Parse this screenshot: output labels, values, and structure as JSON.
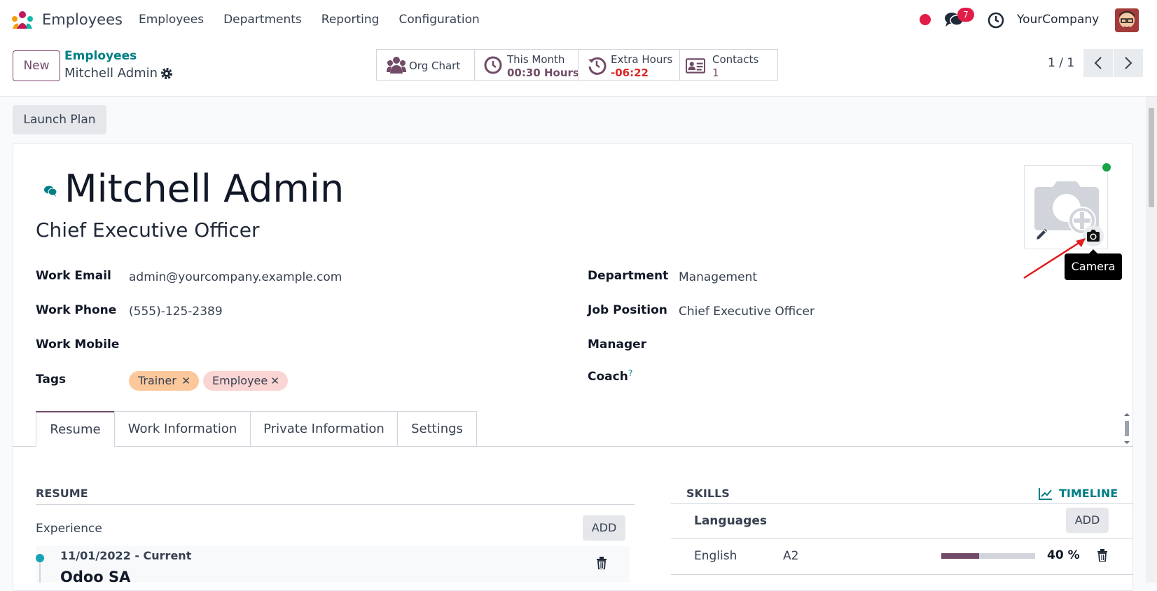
{
  "nav": {
    "app_name": "Employees",
    "menu": [
      "Employees",
      "Departments",
      "Reporting",
      "Configuration"
    ],
    "messages_count": "7",
    "company": "YourCompany"
  },
  "control": {
    "new_label": "New",
    "breadcrumb_parent": "Employees",
    "breadcrumb_current": "Mitchell Admin",
    "smart_buttons": [
      {
        "icon": "org-chart-icon",
        "label": "Org Chart",
        "value": ""
      },
      {
        "icon": "clock-icon",
        "label": "This Month",
        "value": "00:30 Hours",
        "value_color": "#714b67"
      },
      {
        "icon": "history-icon",
        "label": "Extra Hours",
        "value": "-06:22",
        "value_color": "#dc2626"
      },
      {
        "icon": "contact-card-icon",
        "label": "Contacts",
        "value": "1",
        "value_color": "#714b67"
      }
    ],
    "pager": "1 / 1"
  },
  "actions": {
    "launch_plan": "Launch Plan"
  },
  "employee": {
    "name": "Mitchell Admin",
    "job_title": "Chief Executive Officer",
    "photo_tooltip": "Camera",
    "fields_left": [
      {
        "label": "Work Email",
        "value": "admin@yourcompany.example.com"
      },
      {
        "label": "Work Phone",
        "value": "(555)-125-2389"
      },
      {
        "label": "Work Mobile",
        "value": ""
      },
      {
        "label": "Tags",
        "value": ""
      }
    ],
    "tags": [
      {
        "label": "Trainer",
        "color": "#fcc89b"
      },
      {
        "label": "Employee",
        "color": "#fbd5d3"
      }
    ],
    "fields_right": [
      {
        "label": "Department",
        "value": "Management"
      },
      {
        "label": "Job Position",
        "value": "Chief Executive Officer"
      },
      {
        "label": "Manager",
        "value": ""
      },
      {
        "label": "Coach",
        "value": "",
        "help": "?"
      }
    ]
  },
  "tabs": [
    "Resume",
    "Work Information",
    "Private Information",
    "Settings"
  ],
  "resume": {
    "title": "RESUME",
    "section": "Experience",
    "add_label": "ADD",
    "entry_date": "11/01/2022 - Current",
    "entry_company": "Odoo SA"
  },
  "skills": {
    "title": "SKILLS",
    "timeline_label": "TIMELINE",
    "group": "Languages",
    "add_label": "ADD",
    "rows": [
      {
        "name": "English",
        "level": "A2",
        "progress_label": "40 %",
        "progress": 0.4
      }
    ]
  }
}
